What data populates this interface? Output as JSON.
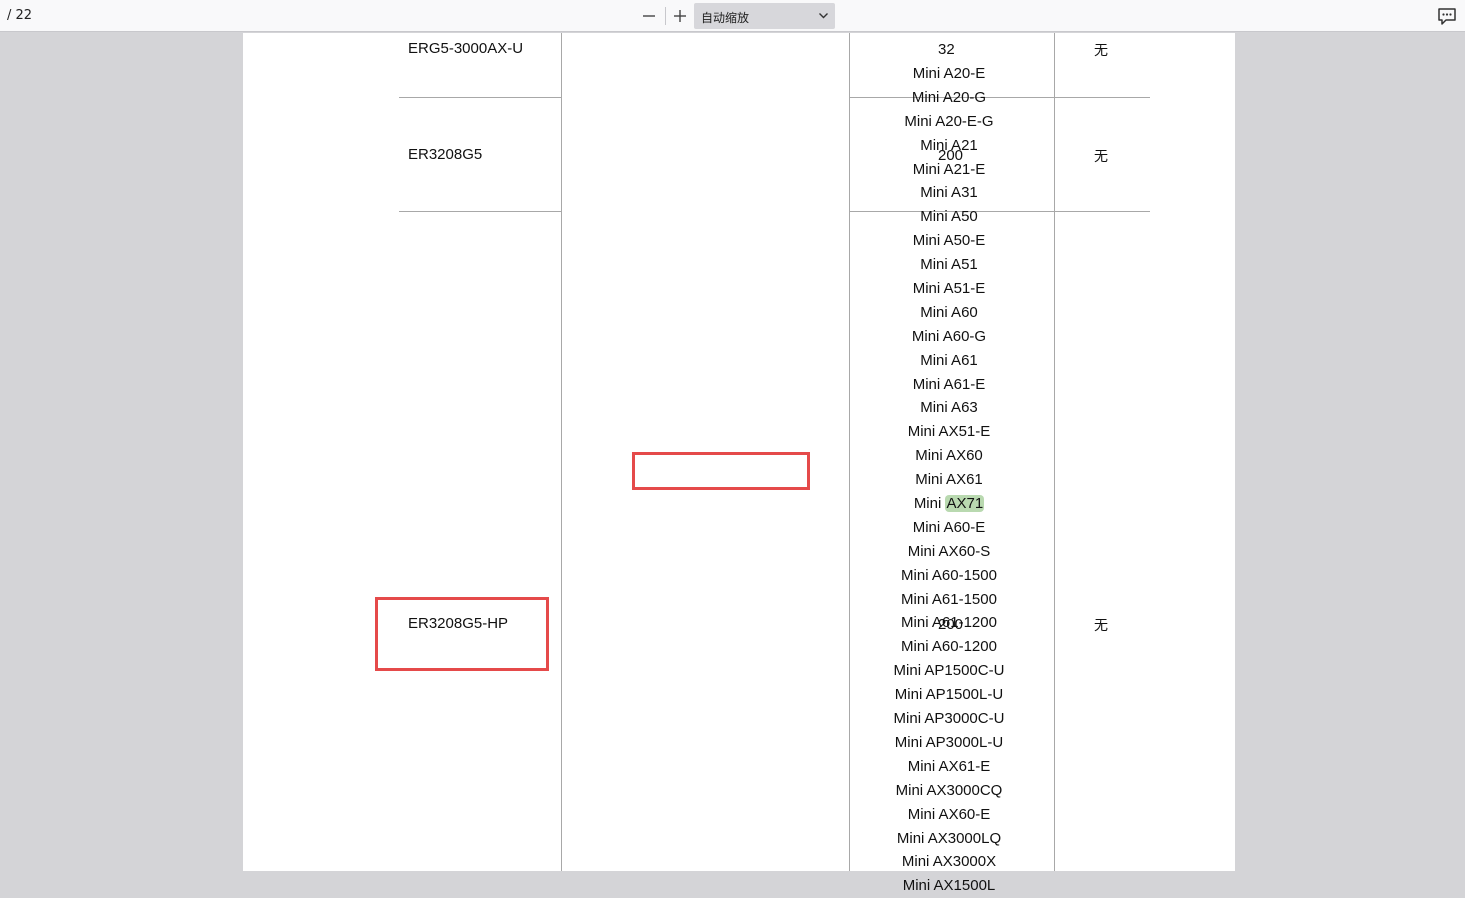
{
  "toolbar": {
    "page_count": "/ 22",
    "zoom_out_label": "—",
    "zoom_in_label": "+",
    "zoom_value": "自动缩放",
    "icons": {
      "zoom_out": "minus-icon",
      "zoom_in": "plus-icon",
      "dropdown": "chevron-down-icon",
      "comment": "comment-icon"
    }
  },
  "table": {
    "rows": [
      {
        "device": "ERG5-3000AX-U",
        "count": "32",
        "remark": "无"
      },
      {
        "device": "ER3208G5",
        "count": "200",
        "remark": "无"
      },
      {
        "device": "ER3208G5-HP",
        "count": "200",
        "remark": "无"
      }
    ],
    "model_list": [
      "Mini A20-E",
      "Mini A20-G",
      "Mini A20-E-G",
      "Mini A21",
      "Mini A21-E",
      "Mini A31",
      "Mini A50",
      "Mini A50-E",
      "Mini A51",
      "Mini A51-E",
      "Mini A60",
      "Mini A60-G",
      "Mini A61",
      "Mini A61-E",
      "Mini A63",
      "Mini AX51-E",
      "Mini AX60",
      "Mini AX61",
      "Mini AX71",
      "Mini A60-E",
      "Mini AX60-S",
      "Mini A60-1500",
      "Mini A61-1500",
      "Mini A61-1200",
      "Mini A60-1200",
      "Mini AP1500C-U",
      "Mini AP1500L-U",
      "Mini AP3000C-U",
      "Mini AP3000L-U",
      "Mini AX61-E",
      "Mini AX3000CQ",
      "Mini AX60-E",
      "Mini AX3000LQ",
      "Mini AX3000X",
      "Mini AX1500L"
    ],
    "search_highlight": {
      "model_index": 18,
      "prefix": "Mini ",
      "match": "AX71"
    }
  },
  "colors": {
    "highlight": "#b9d9b0",
    "annotation_box": "#e54a4a",
    "viewer_background": "#d4d4d7"
  }
}
